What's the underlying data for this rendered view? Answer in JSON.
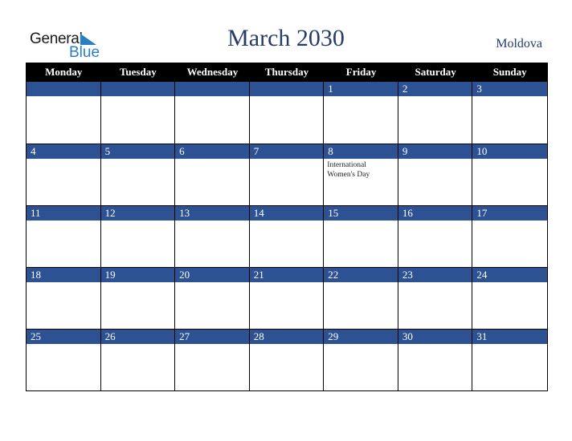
{
  "logo": {
    "line1": "General",
    "line2": "Blue"
  },
  "header": {
    "title": "March 2030",
    "country": "Moldova"
  },
  "colors": {
    "accent": "#2d5294",
    "title": "#233c6a",
    "header_bg": "#000000",
    "logo_blue": "#2a7fc0"
  },
  "weekdays": [
    "Monday",
    "Tuesday",
    "Wednesday",
    "Thursday",
    "Friday",
    "Saturday",
    "Sunday"
  ],
  "weeks": [
    [
      {
        "day": ""
      },
      {
        "day": ""
      },
      {
        "day": ""
      },
      {
        "day": ""
      },
      {
        "day": "1"
      },
      {
        "day": "2"
      },
      {
        "day": "3"
      }
    ],
    [
      {
        "day": "4"
      },
      {
        "day": "5"
      },
      {
        "day": "6"
      },
      {
        "day": "7"
      },
      {
        "day": "8",
        "event": "International Women's Day"
      },
      {
        "day": "9"
      },
      {
        "day": "10"
      }
    ],
    [
      {
        "day": "11"
      },
      {
        "day": "12"
      },
      {
        "day": "13"
      },
      {
        "day": "14"
      },
      {
        "day": "15"
      },
      {
        "day": "16"
      },
      {
        "day": "17"
      }
    ],
    [
      {
        "day": "18"
      },
      {
        "day": "19"
      },
      {
        "day": "20"
      },
      {
        "day": "21"
      },
      {
        "day": "22"
      },
      {
        "day": "23"
      },
      {
        "day": "24"
      }
    ],
    [
      {
        "day": "25"
      },
      {
        "day": "26"
      },
      {
        "day": "27"
      },
      {
        "day": "28"
      },
      {
        "day": "29"
      },
      {
        "day": "30"
      },
      {
        "day": "31"
      }
    ]
  ]
}
